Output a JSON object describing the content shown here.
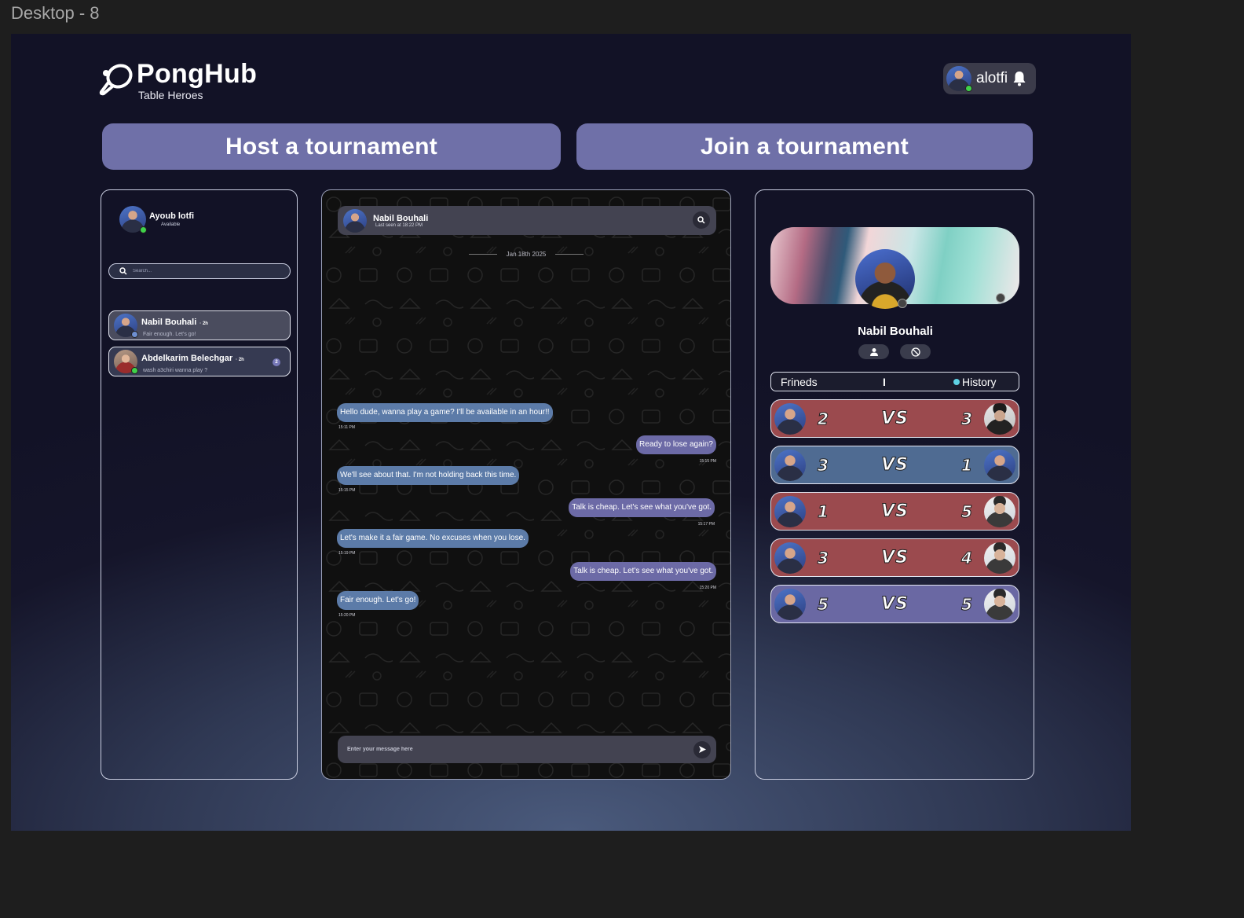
{
  "frame_label": "Desktop - 8",
  "brand": {
    "name": "PongHub",
    "tagline": "Table Heroes"
  },
  "current_user": {
    "username": "alotfi"
  },
  "actions": {
    "host": "Host a tournament",
    "join": "Join a tournament"
  },
  "sidebar": {
    "me": {
      "name": "Ayoub lotfi",
      "status": "Available"
    },
    "search_placeholder": "Search...",
    "contacts": [
      {
        "name": "Nabil Bouhali",
        "time": "· 2h",
        "last_message": "Fair enough. Let's go!",
        "unread": ""
      },
      {
        "name": "Abdelkarim Belechgar",
        "time": "· 2h",
        "last_message": "wash a3chiri wanna play ?",
        "unread": "2"
      }
    ]
  },
  "chat": {
    "contact_name": "Nabil Bouhali",
    "last_seen": "Last seen at 18:22 PM",
    "date": "Jan 18th 2025",
    "messages": [
      {
        "dir": "in",
        "text": "Hello dude, wanna play a game? I'll be available in an hour!!",
        "time": "15:11 PM"
      },
      {
        "dir": "out",
        "text": "Ready to lose again?",
        "time": "15:15 PM"
      },
      {
        "dir": "in",
        "text": "We'll see about that. I'm not holding back this time.",
        "time": "15:15 PM"
      },
      {
        "dir": "out",
        "text": "Talk is cheap. Let's see what you've got.",
        "time": "15:17 PM"
      },
      {
        "dir": "in",
        "text": "Let's make it a fair game. No excuses when you lose.",
        "time": "15:19 PM"
      },
      {
        "dir": "out",
        "text": "Talk is cheap. Let's see what you've got.",
        "time": "15:20 PM"
      },
      {
        "dir": "in",
        "text": "Fair enough. Let's go!",
        "time": "15:20 PM"
      }
    ],
    "input_placeholder": "Enter your message here"
  },
  "profile": {
    "name": "Nabil Bouhali",
    "tabs": {
      "friends": "Frineds",
      "separator": "I",
      "history": "History"
    },
    "matches": [
      {
        "left_score": "2",
        "vs": "VS",
        "right_score": "3",
        "result": "loss",
        "color": "#9b4a4e"
      },
      {
        "left_score": "3",
        "vs": "VS",
        "right_score": "1",
        "result": "win",
        "color": "#4f6b92"
      },
      {
        "left_score": "1",
        "vs": "VS",
        "right_score": "5",
        "result": "loss",
        "color": "#9b4a4e"
      },
      {
        "left_score": "3",
        "vs": "VS",
        "right_score": "4",
        "result": "loss",
        "color": "#9b4a4e"
      },
      {
        "left_score": "5",
        "vs": "VS",
        "right_score": "5",
        "result": "draw",
        "color": "#6a68a3"
      }
    ]
  },
  "icons": {
    "logo": "ping-pong-paddle-icon",
    "notification": "bell-icon",
    "search": "search-icon",
    "send": "send-icon",
    "add_friend": "add-friend-icon",
    "block": "block-icon"
  }
}
